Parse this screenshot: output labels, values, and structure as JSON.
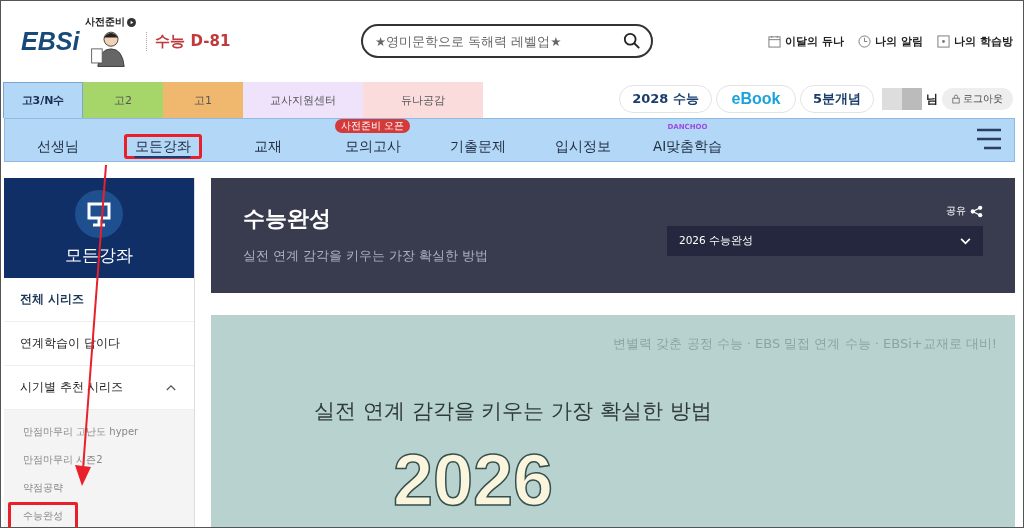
{
  "header": {
    "logo": "EBSi",
    "promo_label": "사전준비",
    "dday": "수능 D-81",
    "search": {
      "placeholder": "★영미문학으로 독해력 레벨업★"
    },
    "quick_links": [
      {
        "label": "이달의 듀나",
        "kind": "calendar"
      },
      {
        "label": "나의 알림",
        "kind": "clock"
      },
      {
        "label": "나의 학습방",
        "kind": "room"
      }
    ]
  },
  "grade_tabs": [
    {
      "label": "고3/N수",
      "selected": true,
      "color": "#b3d7f7"
    },
    {
      "label": "고2",
      "selected": false,
      "color": "#a6d66a"
    },
    {
      "label": "고1",
      "selected": false,
      "color": "#f0b86e"
    },
    {
      "label": "교사지원센터",
      "selected": false,
      "color": "#efe3fb"
    },
    {
      "label": "듀나공감",
      "selected": false,
      "color": "#fbdcdc"
    }
  ],
  "top_buttons": [
    {
      "label": "2028 수능",
      "kind": "text"
    },
    {
      "label": "eBook",
      "kind": "logo"
    },
    {
      "label": "5분개념",
      "kind": "text"
    }
  ],
  "user": {
    "suffix": "님",
    "logout": "로그아웃"
  },
  "nav": {
    "items": [
      {
        "label": "선생님",
        "selected": false,
        "highlighted": false
      },
      {
        "label": "모든강좌",
        "selected": true,
        "highlighted": true
      },
      {
        "label": "교재",
        "selected": false,
        "highlighted": false
      },
      {
        "label": "모의고사",
        "selected": false,
        "highlighted": false,
        "badge": "사전준비 오픈"
      },
      {
        "label": "기출문제",
        "selected": false,
        "highlighted": false
      },
      {
        "label": "입시정보",
        "selected": false,
        "highlighted": false
      },
      {
        "label": "AI맞춤학습",
        "selected": false,
        "highlighted": false,
        "super": "DANCHOO"
      }
    ]
  },
  "sidebar": {
    "title": "모든강좌",
    "items": [
      {
        "label": "전체 시리즈",
        "selected": true
      },
      {
        "label": "연계학습이 답이다",
        "selected": false
      },
      {
        "label": "시기별 추천 시리즈",
        "selected": false,
        "expanded": true,
        "children": [
          {
            "label": "만점마무리 고난도 hyper",
            "highlighted": false
          },
          {
            "label": "만점마무리 시즌2",
            "highlighted": false
          },
          {
            "label": "약점공략",
            "highlighted": false
          },
          {
            "label": "수능완성",
            "highlighted": true
          }
        ]
      }
    ]
  },
  "main": {
    "title": "수능완성",
    "subtitle": "실전 연계 감각을 키우는 가장 확실한 방법",
    "share": "공유",
    "select": {
      "value": "2026 수능완성"
    },
    "banner": {
      "tagline": "변별력 갖춘 공정 수능 · EBS 밀접 연계 수능 · EBSi+교재로 대비!",
      "headline": "실전 연계 감각을 키우는 가장 확실한 방법",
      "year": "2026"
    }
  }
}
